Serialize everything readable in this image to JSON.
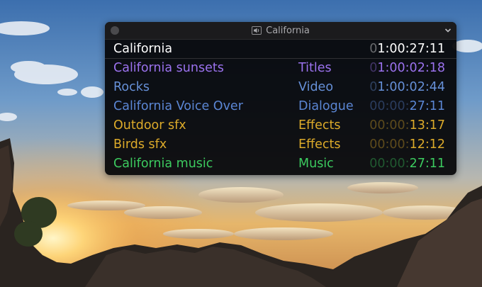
{
  "window": {
    "title": "California"
  },
  "colors": {
    "white": "#ffffff",
    "titles": "#9b72ee",
    "video": "#6690d8",
    "dialogue": "#5b86d4",
    "effects": "#dcaa2a",
    "music": "#3ccb5f"
  },
  "header": {
    "name": "California",
    "time_dim": "0",
    "time_bright": "1:00:27:11"
  },
  "rows": [
    {
      "name": "California sunsets",
      "role": "Titles",
      "time_dim": "0",
      "time_bright": "1:00:02:18",
      "color": "titles"
    },
    {
      "name": "Rocks",
      "role": "Video",
      "time_dim": "0",
      "time_bright": "1:00:02:44",
      "color": "video"
    },
    {
      "name": "California Voice Over",
      "role": "Dialogue",
      "time_dim": "00:00:",
      "time_bright": "27:11",
      "color": "dialogue"
    },
    {
      "name": "Outdoor sfx",
      "role": "Effects",
      "time_dim": "00:00:",
      "time_bright": "13:17",
      "color": "effects"
    },
    {
      "name": "Birds sfx",
      "role": "Effects",
      "time_dim": "00:00:",
      "time_bright": "12:12",
      "color": "effects"
    },
    {
      "name": "California music",
      "role": "Music",
      "time_dim": "00:00:",
      "time_bright": "27:11",
      "color": "music"
    }
  ]
}
